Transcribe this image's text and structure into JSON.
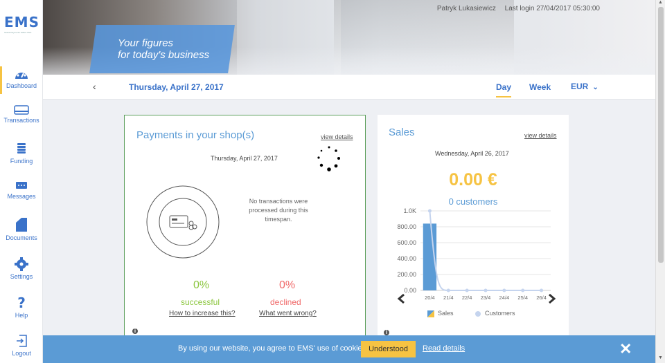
{
  "brand": {
    "logo": "EMS",
    "logo_sub": "Global Payments Tables Web"
  },
  "header": {
    "user_name": "Patryk Lukasiewicz",
    "last_login": "Last login 27/04/2017 05:30:00",
    "tagline_1": "Your figures",
    "tagline_2": "for today's business"
  },
  "sidebar": {
    "items": [
      {
        "label": "Dashboard",
        "icon": "dashboard-icon"
      },
      {
        "label": "Transactions",
        "icon": "card-icon"
      },
      {
        "label": "Funding",
        "icon": "coins-icon"
      },
      {
        "label": "Messages",
        "icon": "message-icon"
      },
      {
        "label": "Documents",
        "icon": "document-icon"
      },
      {
        "label": "Settings",
        "icon": "gear-icon"
      },
      {
        "label": "Help",
        "icon": "question-icon"
      },
      {
        "label": "Logout",
        "icon": "logout-icon"
      }
    ]
  },
  "datebar": {
    "date": "Thursday, April 27, 2017",
    "period_day": "Day",
    "period_week": "Week",
    "currency": "EUR"
  },
  "payments": {
    "title": "Payments in your shop(s)",
    "view_details": "view details",
    "date": "Thursday, April 27, 2017",
    "no_tx": "No transactions were processed during this timespan.",
    "success_pct": "0%",
    "success_label": "successful",
    "success_help": "How to increase this?",
    "declined_pct": "0%",
    "declined_label": "declined",
    "declined_help": "What went wrong?"
  },
  "sales": {
    "title": "Sales",
    "view_details": "view details",
    "date": "Wednesday, April 26, 2017",
    "amount": "0.00 €",
    "customers": "0 customers",
    "legend_sales": "Sales",
    "legend_customers": "Customers"
  },
  "chart_data": {
    "type": "bar",
    "categories": [
      "20/4",
      "21/4",
      "22/4",
      "23/4",
      "24/4",
      "25/4",
      "26/4"
    ],
    "series": [
      {
        "name": "Sales",
        "type": "bar",
        "values": [
          840,
          0,
          0,
          0,
          0,
          0,
          0
        ]
      },
      {
        "name": "Customers",
        "type": "line",
        "values": [
          1000,
          0,
          0,
          0,
          0,
          0,
          0
        ]
      }
    ],
    "y_ticks": [
      "0.00",
      "200.00",
      "400.00",
      "600.00",
      "800.00",
      "1.0K"
    ],
    "ylim": [
      0,
      1000
    ],
    "grid": true,
    "legend": "bottom",
    "colors": {
      "sales": "#5b9bd5",
      "customers": "#c5d4ee"
    }
  },
  "cookie": {
    "text": "By using our website, you agree to EMS' use of cookies.",
    "button": "Understood",
    "link": "Read details",
    "close": "✕"
  },
  "colors": {
    "accent": "#3a72c9",
    "highlight": "#f6c343",
    "success": "#8cc63f",
    "danger": "#f06a6a",
    "cookie_bar": "#5b9bd5"
  }
}
